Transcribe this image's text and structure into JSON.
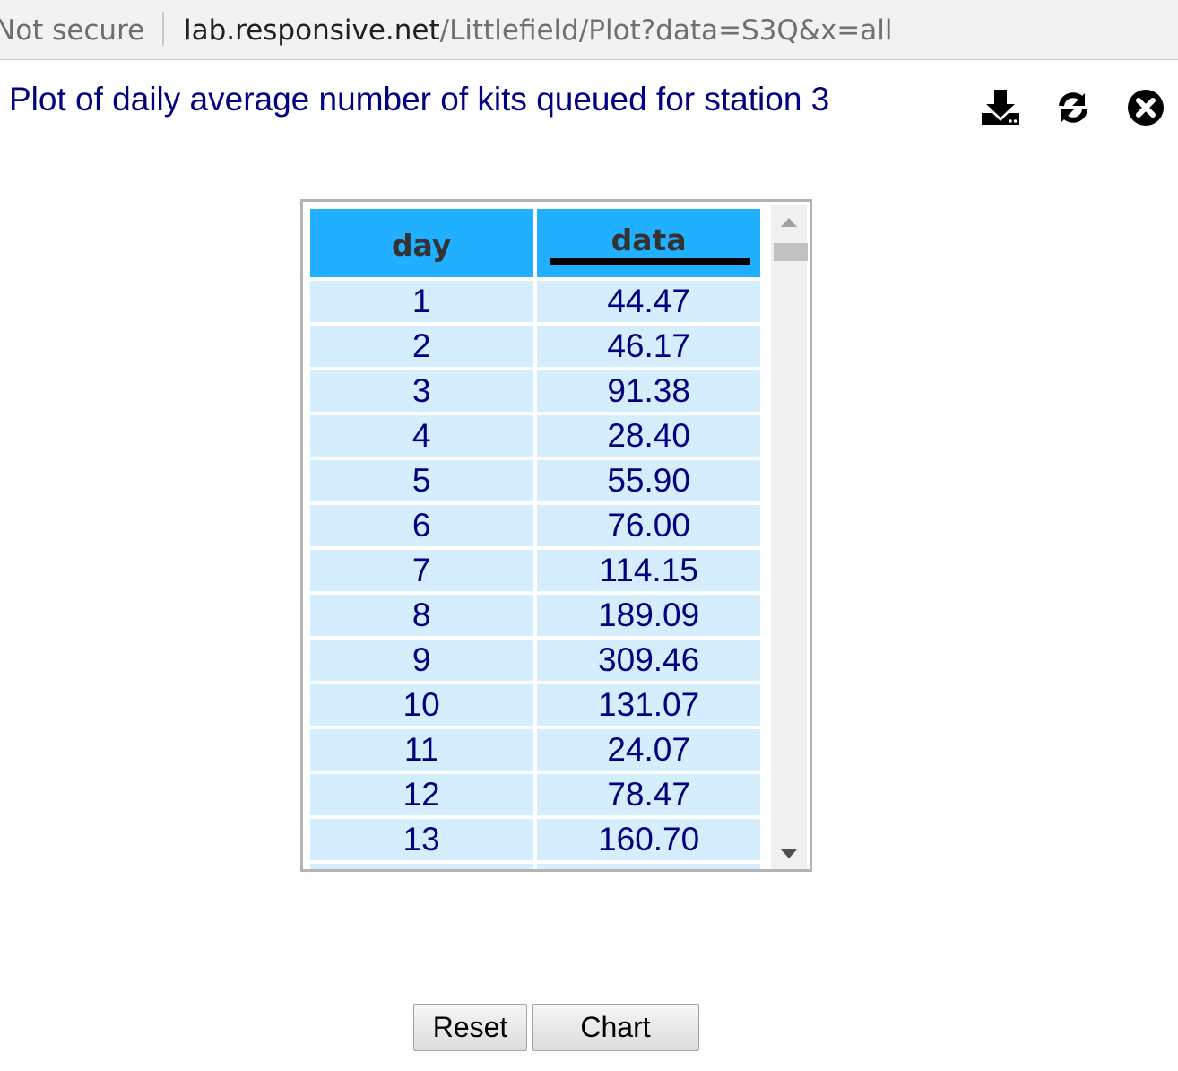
{
  "browser": {
    "security_label": "Not secure",
    "url_host": "lab.responsive.net",
    "url_path": "/Littlefield/Plot?data=S3Q&x=all"
  },
  "page": {
    "title": "Plot of daily average number of kits queued for station 3",
    "toolbar_icons": [
      "download-icon",
      "refresh-icon",
      "close-icon"
    ]
  },
  "table": {
    "columns": [
      "day",
      "data"
    ],
    "sorted_column": "data",
    "rows": [
      {
        "day": "1",
        "data": "44.47"
      },
      {
        "day": "2",
        "data": "46.17"
      },
      {
        "day": "3",
        "data": "91.38"
      },
      {
        "day": "4",
        "data": "28.40"
      },
      {
        "day": "5",
        "data": "55.90"
      },
      {
        "day": "6",
        "data": "76.00"
      },
      {
        "day": "7",
        "data": "114.15"
      },
      {
        "day": "8",
        "data": "189.09"
      },
      {
        "day": "9",
        "data": "309.46"
      },
      {
        "day": "10",
        "data": "131.07"
      },
      {
        "day": "11",
        "data": "24.07"
      },
      {
        "day": "12",
        "data": "78.47"
      },
      {
        "day": "13",
        "data": "160.70"
      },
      {
        "day": "",
        "data": ""
      }
    ]
  },
  "buttons": {
    "reset_label": "Reset",
    "chart_label": "Chart"
  },
  "colors": {
    "title": "#000080",
    "header_bg": "#21b0ff",
    "cell_bg": "#d4eefd",
    "cell_text": "#000080"
  }
}
